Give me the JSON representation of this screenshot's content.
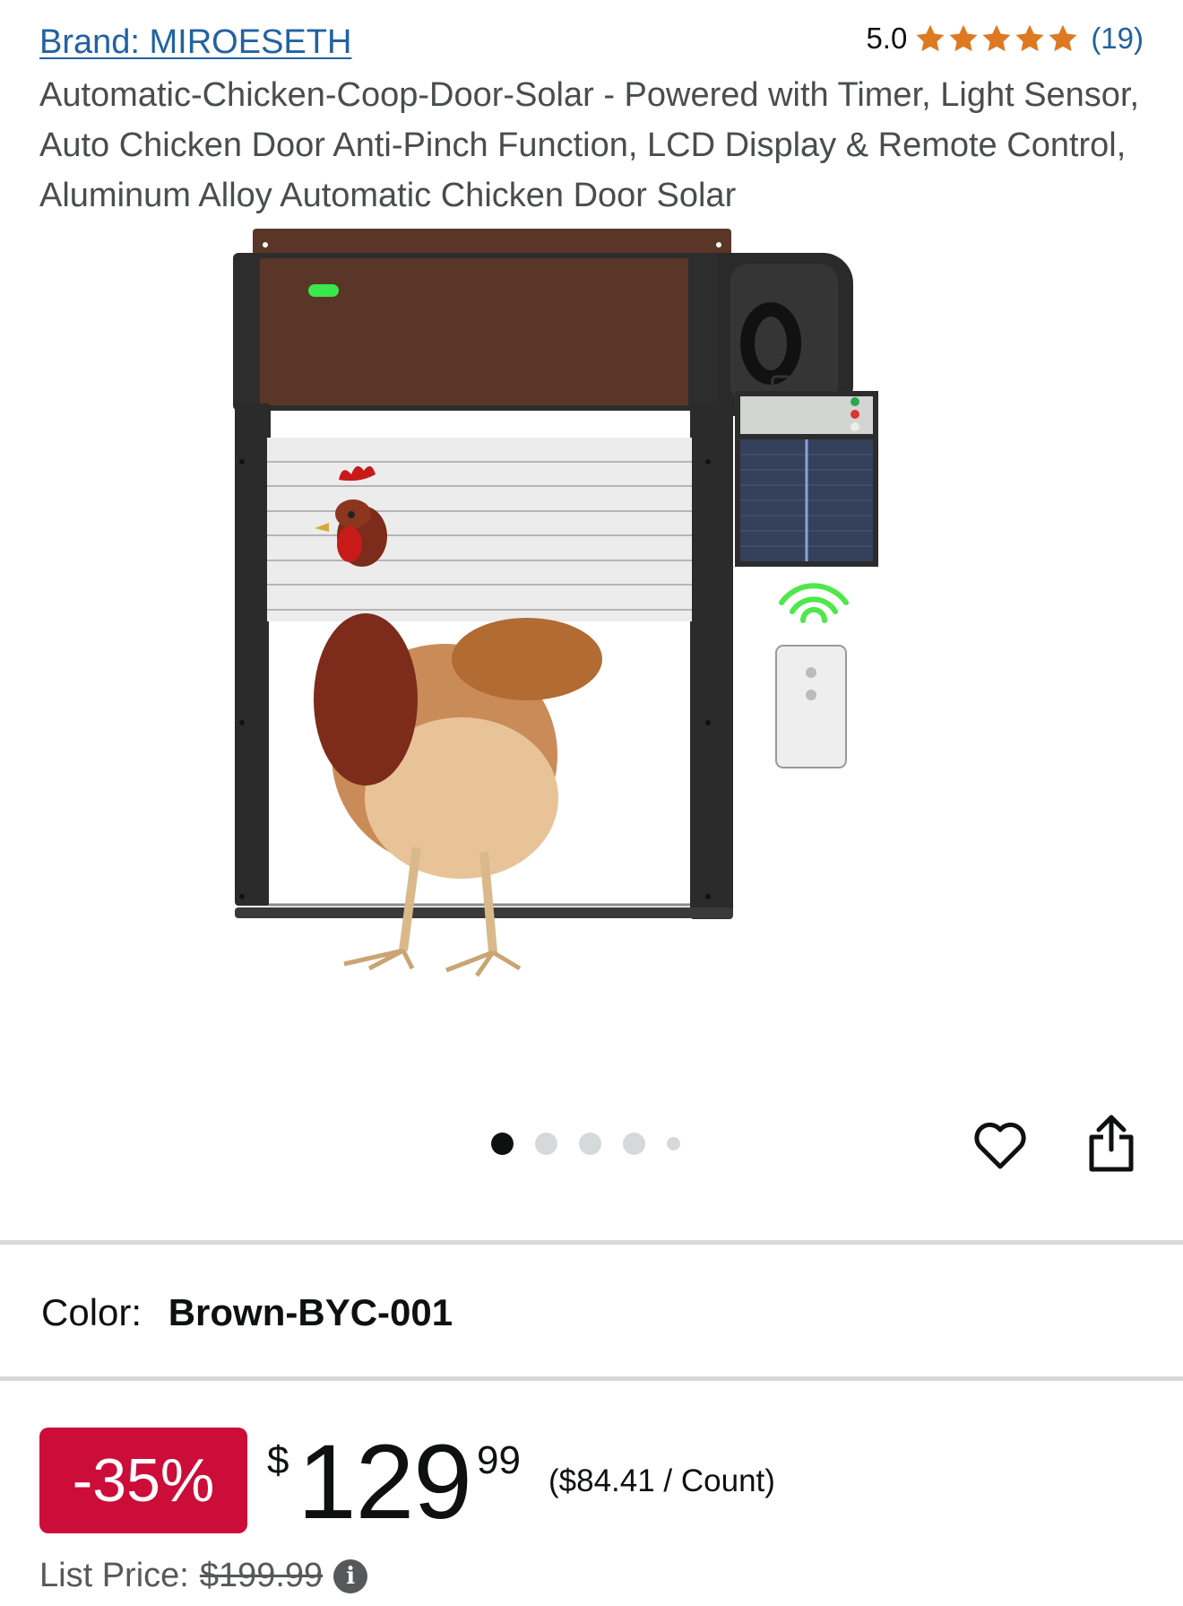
{
  "header": {
    "brand_link": "Brand: MIROESETH",
    "rating_value": "5.0",
    "rating_stars": 5,
    "review_count": "(19)"
  },
  "product": {
    "title": "Automatic-Chicken-Coop-Door-Solar - Powered with Timer, Light Sensor, Auto Chicken Door Anti-Pinch Function, LCD Display & Remote Control, Aluminum Alloy Automatic Chicken Door Solar"
  },
  "gallery": {
    "dot_count": 5,
    "active_index": 0
  },
  "variant": {
    "color_label": "Color:",
    "color_value": "Brown-BYC-001"
  },
  "pricing": {
    "discount": "-35%",
    "currency_symbol": "$",
    "price_whole": "129",
    "price_fraction": "99",
    "unit_price": "($84.41 / Count)",
    "list_price_label": "List Price:",
    "list_price_value": "$199.99",
    "info_icon": "i"
  },
  "colors": {
    "link": "#2162a1",
    "star": "#de7921",
    "discount_badge": "#cc0c39",
    "door_brown": "#5a3628",
    "indicator_green": "#39e84a"
  }
}
